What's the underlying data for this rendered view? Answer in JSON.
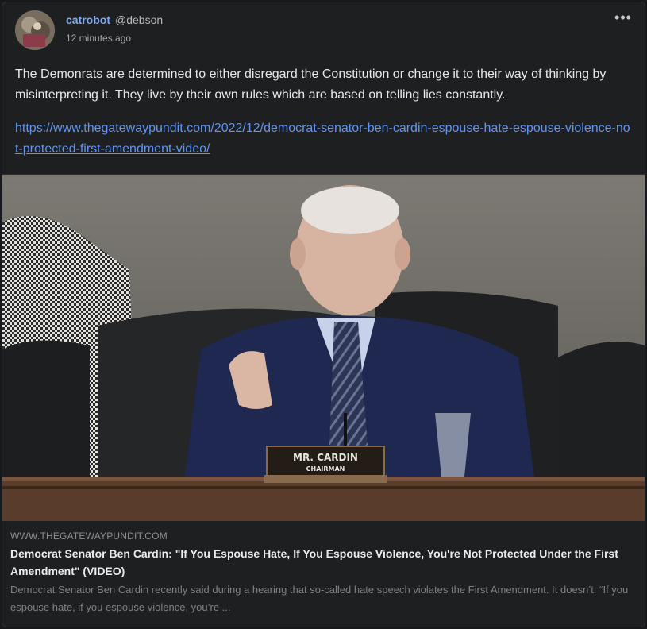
{
  "post": {
    "author_name": "catrobot",
    "author_handle": "@debson",
    "timestamp": "12 minutes ago",
    "menu_icon": "ellipsis-icon",
    "body": "The Demonrats are determined to either disregard the Constitution or change it to their way of thinking by misinterpreting it. They live by their own rules which are based on telling lies constantly.",
    "link_text": "https://www.thegatewaypundit.com/2022/12/democrat-senator-ben-cardin-espouse-hate-espouse-violence-not-protected-first-amendment-video/"
  },
  "card": {
    "nameplate_line1": "MR. CARDIN",
    "nameplate_line2": "CHAIRMAN",
    "domain": "WWW.THEGATEWAYPUNDIT.COM",
    "title": "Democrat Senator Ben Cardin: \"If You Espouse Hate, If You Espouse Violence, You're Not Protected Under the First Amendment\" (VIDEO)",
    "description": "Democrat Senator Ben Cardin recently said during a hearing that so-called hate speech violates the First Amendment. It doesn’t. “If you espouse hate, if you espouse violence, you’re ..."
  },
  "colors": {
    "background": "#18191b",
    "link": "#5f95f1",
    "author": "#7eaaf2"
  }
}
